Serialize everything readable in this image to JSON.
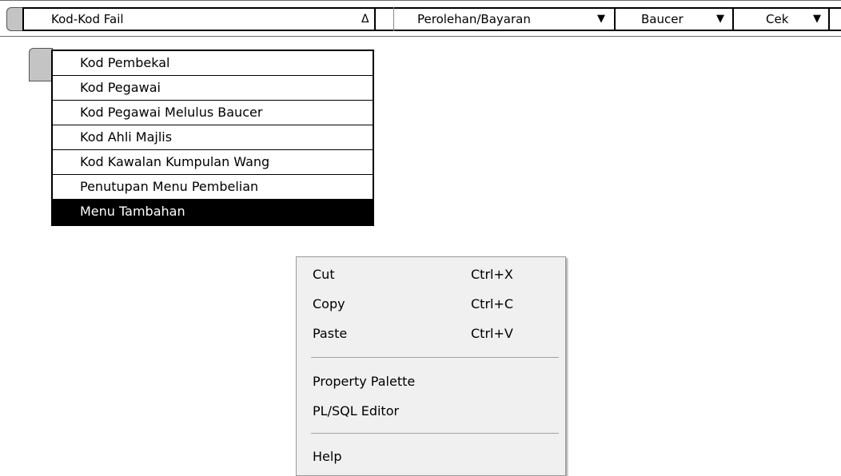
{
  "menubar": {
    "file_codes": "Kod-Kod Fail",
    "file_codes_arrow": "Δ",
    "receipts": "Perolehan/Bayaran",
    "voucher": "Baucer",
    "cheque": "Cek",
    "dropdown_arrow": "▼"
  },
  "dropdown": {
    "items": [
      "Kod Pembekal",
      "Kod Pegawai",
      "Kod Pegawai Melulus Baucer",
      "Kod Ahli Majlis",
      "Kod Kawalan Kumpulan Wang",
      "Penutupan Menu Pembelian",
      "Menu Tambahan"
    ]
  },
  "context_menu": {
    "cut": {
      "label": "Cut",
      "shortcut": "Ctrl+X"
    },
    "copy": {
      "label": "Copy",
      "shortcut": "Ctrl+C"
    },
    "paste": {
      "label": "Paste",
      "shortcut": "Ctrl+V"
    },
    "property_palette": "Property Palette",
    "plsql_editor": "PL/SQL Editor",
    "help": "Help"
  }
}
